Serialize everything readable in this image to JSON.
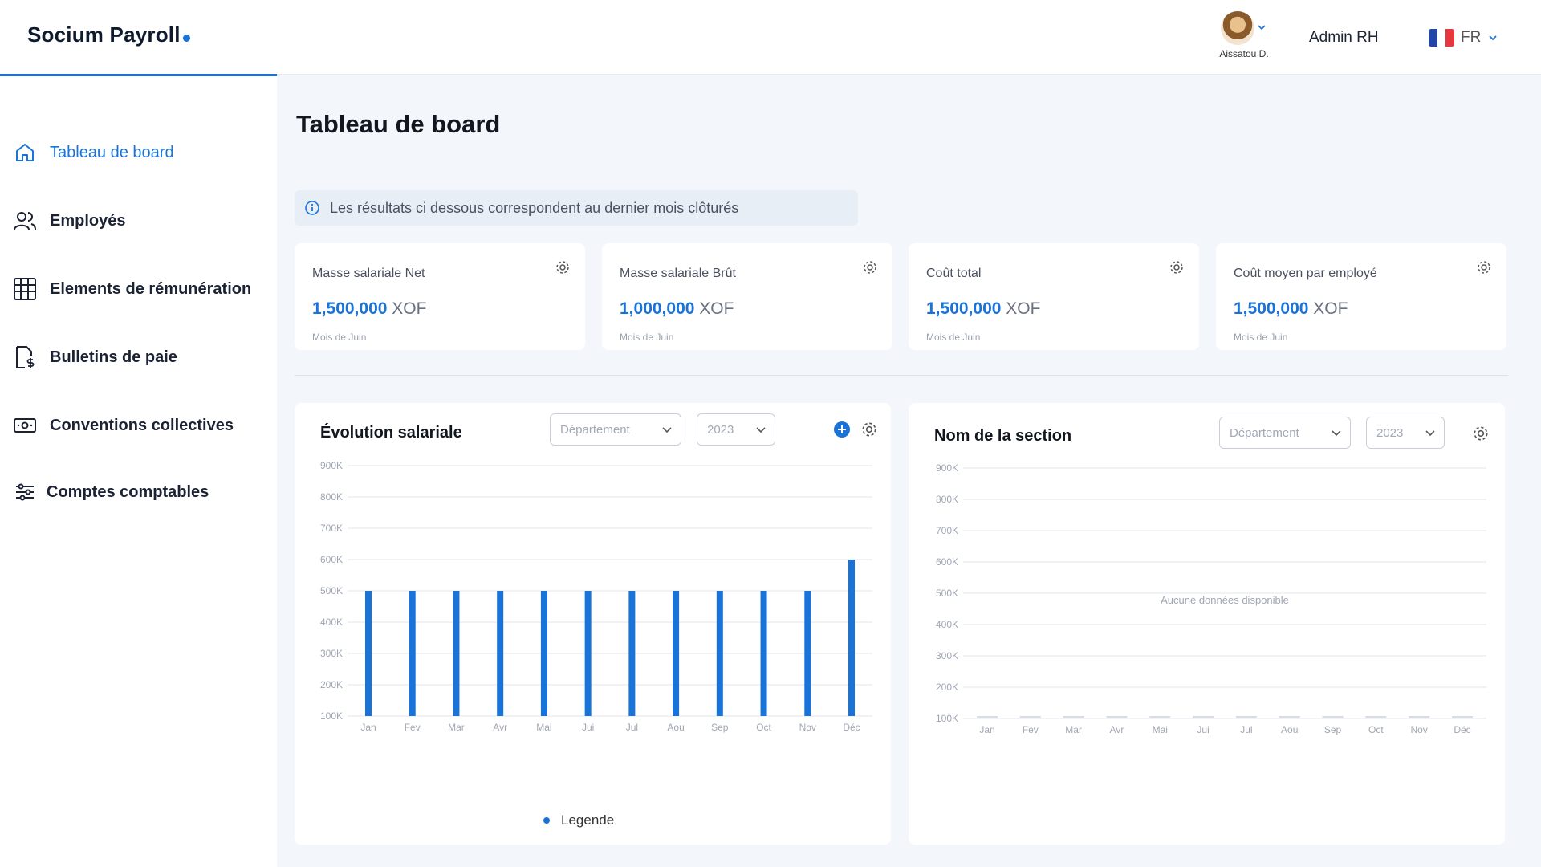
{
  "header": {
    "logo": "Socium Payroll",
    "user_name": "Aissatou D.",
    "role": "Admin RH",
    "language": "FR"
  },
  "sidebar": {
    "items": [
      {
        "label": "Tableau de board",
        "icon": "home-icon",
        "active": true
      },
      {
        "label": "Employés",
        "icon": "users-icon",
        "active": false
      },
      {
        "label": "Elements de rémunération",
        "icon": "grid-table-icon",
        "active": false
      },
      {
        "label": "Bulletins de paie",
        "icon": "payslip-icon",
        "active": false
      },
      {
        "label": "Conventions collectives",
        "icon": "money-bill-icon",
        "active": false
      },
      {
        "label": "Comptes comptables",
        "icon": "sliders-icon",
        "active": false
      }
    ]
  },
  "main": {
    "title": "Tableau de board",
    "info": "Les résultats ci dessous correspondent au dernier mois clôturés",
    "kpis": [
      {
        "label": "Masse salariale Net",
        "value": "1,500,000",
        "unit": "XOF",
        "sub": "Mois de Juin"
      },
      {
        "label": "Masse salariale Brût",
        "value": "1,000,000",
        "unit": "XOF",
        "sub": "Mois de Juin"
      },
      {
        "label": "Coût total",
        "value": "1,500,000",
        "unit": "XOF",
        "sub": "Mois de Juin"
      },
      {
        "label": "Coût moyen par employé",
        "value": "1,500,000",
        "unit": "XOF",
        "sub": "Mois de Juin"
      }
    ],
    "panel1": {
      "title": "Évolution salariale",
      "department_placeholder": "Département",
      "year": "2023",
      "legend": "Legende"
    },
    "panel2": {
      "title": "Nom de la section",
      "department_placeholder": "Département",
      "year": "2023",
      "empty_message": "Aucune données disponible"
    }
  },
  "colors": {
    "accent": "#1a73d9",
    "bar": "#1a73d9",
    "empty_bar": "#d9dde3"
  },
  "chart_data": [
    {
      "type": "bar",
      "title": "Évolution salariale",
      "categories": [
        "Jan",
        "Fev",
        "Mar",
        "Avr",
        "Mai",
        "Jui",
        "Jul",
        "Aou",
        "Sep",
        "Oct",
        "Nov",
        "Déc"
      ],
      "y_ticks": [
        "100K",
        "200K",
        "300K",
        "400K",
        "500K",
        "600K",
        "700K",
        "800K",
        "900K"
      ],
      "ylim": [
        100000,
        900000
      ],
      "series": [
        {
          "name": "Legende",
          "values": [
            500000,
            500000,
            500000,
            500000,
            500000,
            500000,
            500000,
            500000,
            500000,
            500000,
            500000,
            600000
          ]
        }
      ],
      "grid": true,
      "legend_position": "bottom-center"
    },
    {
      "type": "bar",
      "title": "Nom de la section",
      "categories": [
        "Jan",
        "Fev",
        "Mar",
        "Avr",
        "Mai",
        "Jui",
        "Jul",
        "Aou",
        "Sep",
        "Oct",
        "Nov",
        "Déc"
      ],
      "y_ticks": [
        "100K",
        "200K",
        "300K",
        "400K",
        "500K",
        "600K",
        "700K",
        "800K",
        "900K"
      ],
      "ylim": [
        100000,
        900000
      ],
      "series": [],
      "grid": true
    }
  ]
}
